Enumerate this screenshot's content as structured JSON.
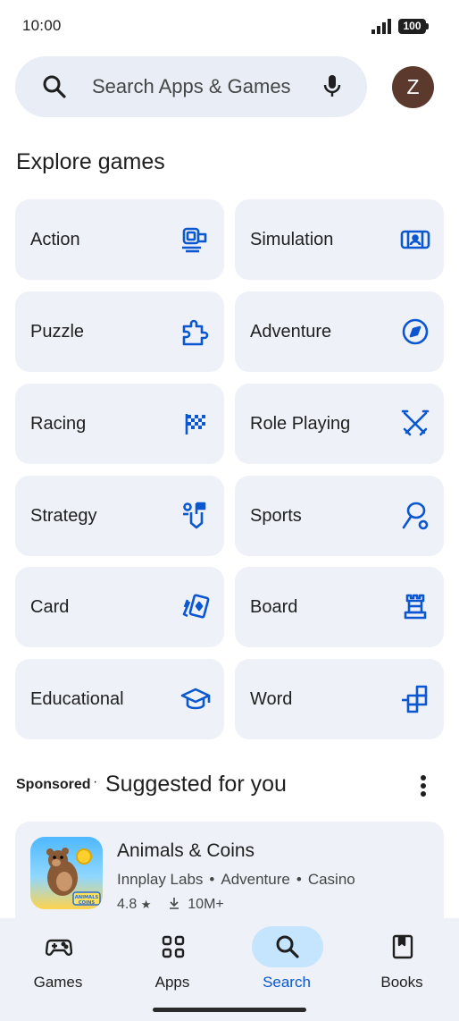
{
  "status_bar": {
    "time": "10:00",
    "battery": "100"
  },
  "search": {
    "placeholder": "Search Apps & Games",
    "avatar_initial": "Z"
  },
  "explore": {
    "title": "Explore games",
    "categories": [
      {
        "label": "Action",
        "icon": "action-icon"
      },
      {
        "label": "Simulation",
        "icon": "simulation-icon"
      },
      {
        "label": "Puzzle",
        "icon": "puzzle-icon"
      },
      {
        "label": "Adventure",
        "icon": "compass-icon"
      },
      {
        "label": "Racing",
        "icon": "checkered-flag-icon"
      },
      {
        "label": "Role Playing",
        "icon": "crossed-swords-icon"
      },
      {
        "label": "Strategy",
        "icon": "strategy-icon"
      },
      {
        "label": "Sports",
        "icon": "sports-icon"
      },
      {
        "label": "Card",
        "icon": "cards-icon"
      },
      {
        "label": "Board",
        "icon": "chess-rook-icon"
      },
      {
        "label": "Educational",
        "icon": "graduation-cap-icon"
      },
      {
        "label": "Word",
        "icon": "word-tiles-icon"
      }
    ]
  },
  "suggested": {
    "sponsored": "Sponsored",
    "separator": "·",
    "title": "Suggested for you",
    "app": {
      "name": "Animals & Coins",
      "developer": "Innplay Labs",
      "genre1": "Adventure",
      "genre2": "Casino",
      "rating": "4.8",
      "downloads": "10M+",
      "thumb_label": "ANIMALS COINS"
    }
  },
  "nav": {
    "items": [
      {
        "label": "Games",
        "icon": "gamepad-icon",
        "active": false
      },
      {
        "label": "Apps",
        "icon": "apps-grid-icon",
        "active": false
      },
      {
        "label": "Search",
        "icon": "search-icon",
        "active": true
      },
      {
        "label": "Books",
        "icon": "book-icon",
        "active": false
      }
    ]
  },
  "colors": {
    "accent": "#0b57d0",
    "tile_bg": "#eef1f8",
    "search_bg": "#e8edf6",
    "active_pill": "#c5e5fe"
  }
}
